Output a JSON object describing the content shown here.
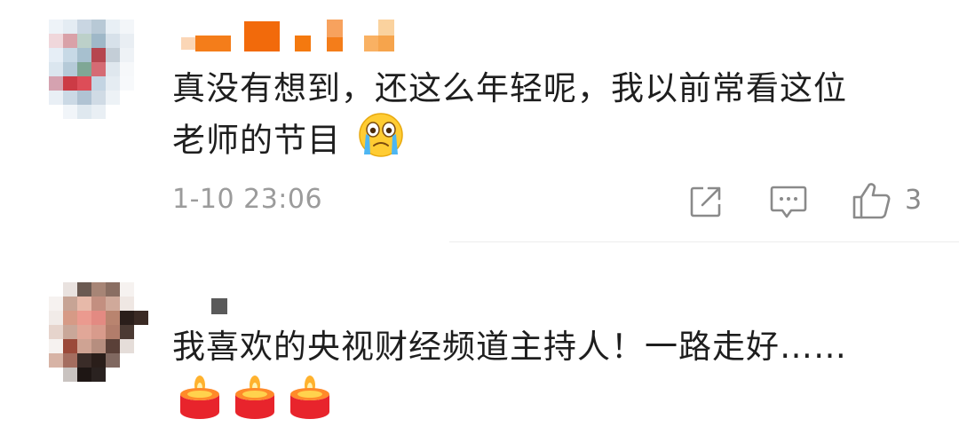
{
  "comments": [
    {
      "text_line1": "真没有想到，还这么年轻呢，我以前常看这位",
      "text_line2": "老师的节目",
      "emoji": "loudly-crying-face",
      "timestamp": "1-10 23:06",
      "actions": [
        "share-icon",
        "comment-icon",
        "like-icon"
      ],
      "like_count": "3",
      "username_color": "#f47d1a",
      "avatar_colors": [
        "#b9c7d6",
        "#d38f94",
        "#8fae9c",
        "#cc3b45",
        "#e7eef4"
      ]
    },
    {
      "text_line1": "我喜欢的央视财经频道主持人！一路走好……",
      "emoji": "candle",
      "emoji_count": 3,
      "username_color": "#555555",
      "avatar_colors": [
        "#2a1e1a",
        "#d69a86",
        "#f6f2f0",
        "#8a6a5e"
      ]
    }
  ]
}
